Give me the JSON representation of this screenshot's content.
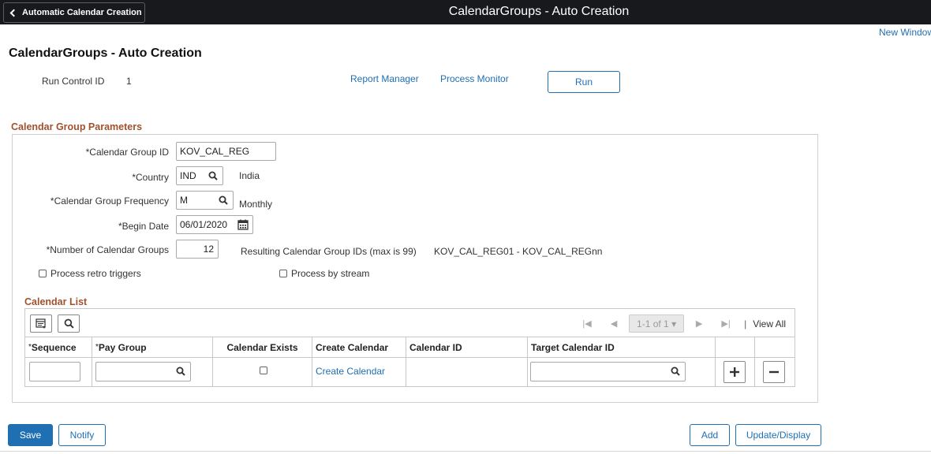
{
  "header": {
    "back_label": "Automatic Calendar Creation",
    "app_title": "CalendarGroups - Auto Creation"
  },
  "new_window": "New Window",
  "page_title": "CalendarGroups - Auto Creation",
  "run_control": {
    "label": "Run Control ID",
    "value": "1",
    "report_manager": "Report Manager",
    "process_monitor": "Process Monitor",
    "run_label": "Run"
  },
  "params": {
    "section_title": "Calendar Group Parameters",
    "calendar_group_id": {
      "label": "*Calendar Group ID",
      "value": "KOV_CAL_REG"
    },
    "country": {
      "label": "*Country",
      "value": "IND",
      "description": "India"
    },
    "frequency": {
      "label": "*Calendar Group Frequency",
      "value": "M",
      "description": "Monthly"
    },
    "begin_date": {
      "label": "*Begin Date",
      "value": "06/01/2020"
    },
    "num_groups": {
      "label": "*Number of Calendar Groups",
      "value": "12"
    },
    "resulting": {
      "label": "Resulting Calendar Group IDs (max is 99)",
      "value": "KOV_CAL_REG01 - KOV_CAL_REGnn"
    },
    "process_retro": {
      "label": "Process retro triggers",
      "checked": false
    },
    "process_stream": {
      "label": "Process by stream",
      "checked": false
    }
  },
  "calendar_list": {
    "title": "Calendar List",
    "pager": {
      "count": "1-1 of 1",
      "view_all": "View All"
    },
    "columns": {
      "sequence": "Sequence",
      "pay_group": "Pay Group",
      "calendar_exists": "Calendar Exists",
      "create_calendar": "Create Calendar",
      "calendar_id": "Calendar ID",
      "target_calendar_id": "Target Calendar ID"
    },
    "row": {
      "sequence": "",
      "pay_group": "",
      "calendar_exists": false,
      "create_calendar_link": "Create Calendar",
      "calendar_id": "",
      "target_calendar_id": ""
    }
  },
  "footer": {
    "save": "Save",
    "notify": "Notify",
    "add": "Add",
    "update_display": "Update/Display"
  },
  "colors": {
    "header_bg": "#17191d",
    "link": "#1f6fb3",
    "section_title": "#a0522d",
    "primary_button": "#1f6fb3"
  }
}
